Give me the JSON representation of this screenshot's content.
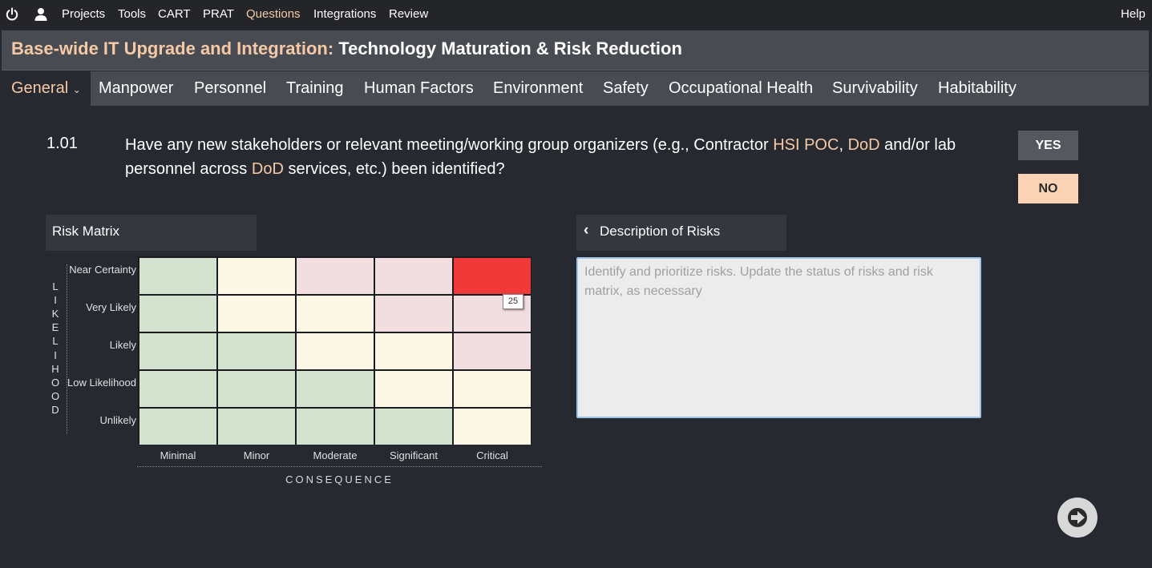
{
  "topnav": {
    "items": [
      "Projects",
      "Tools",
      "CART",
      "PRAT",
      "Questions",
      "Integrations",
      "Review"
    ],
    "active": "Questions",
    "help": "Help"
  },
  "header": {
    "project": "Base-wide IT Upgrade and Integration:",
    "section": "Technology Maturation & Risk Reduction"
  },
  "tabs": [
    "General",
    "Manpower",
    "Personnel",
    "Training",
    "Human Factors",
    "Environment",
    "Safety",
    "Occupational Health",
    "Survivability",
    "Habitability"
  ],
  "question": {
    "number": "1.01",
    "parts": [
      "Have any new stakeholders or relevant meeting/working group organizers (e.g., Contractor ",
      "HSI POC",
      ", ",
      "DoD",
      " and/or lab personnel across ",
      "DoD",
      " services, etc.) been identified?"
    ],
    "yes_label": "YES",
    "no_label": "NO",
    "selected": "NO"
  },
  "risk_matrix": {
    "title": "Risk Matrix",
    "likelihood_label": "LIKELIHOOD",
    "consequence_label": "CONSEQUENCE",
    "rows": [
      "Near Certainty",
      "Very Likely",
      "Likely",
      "Low Likelihood",
      "Unlikely"
    ],
    "columns": [
      "Minimal",
      "Minor",
      "Moderate",
      "Significant",
      "Critical"
    ],
    "cell_levels": [
      [
        "green",
        "yellow",
        "pink",
        "pink",
        "red"
      ],
      [
        "green",
        "yellow",
        "yellow",
        "pink",
        "pink"
      ],
      [
        "green",
        "green",
        "yellow",
        "yellow",
        "pink"
      ],
      [
        "green",
        "green",
        "green",
        "yellow",
        "yellow"
      ],
      [
        "green",
        "green",
        "green",
        "green",
        "yellow"
      ]
    ],
    "colors": {
      "green": "#d3e3d0",
      "yellow": "#fdf7e6",
      "pink": "#f2dde0",
      "red": "#f03a3a"
    },
    "selected_cell": {
      "row": "Near Certainty",
      "column": "Critical"
    },
    "tooltip": "25"
  },
  "description": {
    "title": "Description of Risks",
    "placeholder": "Identify and prioritize risks. Update the status of risks and risk matrix, as necessary"
  },
  "icons": {
    "power": "power-icon",
    "user": "user-icon",
    "back": "chevron-left-icon",
    "next": "arrow-right-icon"
  },
  "accent": "#f6c9a6"
}
